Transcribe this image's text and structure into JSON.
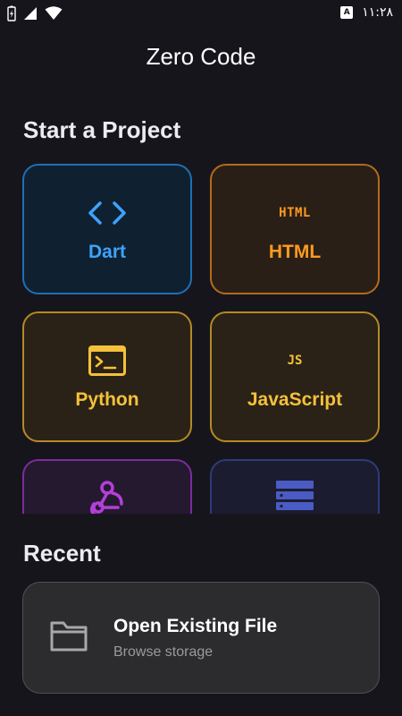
{
  "status_bar": {
    "time": "١١:٢٨",
    "badge_letter": "A",
    "icons": [
      "battery-charging-icon",
      "signal-icon",
      "wifi-icon"
    ]
  },
  "app": {
    "title": "Zero Code"
  },
  "start_section": {
    "heading": "Start a Project",
    "projects": [
      {
        "label": "Dart",
        "icon": "code-brackets-icon",
        "color": "#3ea2ff"
      },
      {
        "label": "HTML",
        "icon": "html-icon",
        "icon_text": "HTML",
        "color": "#ff9a1f"
      },
      {
        "label": "Python",
        "icon": "terminal-icon",
        "color": "#f5c13a"
      },
      {
        "label": "JavaScript",
        "icon": "js-icon",
        "icon_text": "JS",
        "color": "#f5c13a"
      },
      {
        "label": "",
        "icon": "webhook-icon",
        "color": "#b43fd9"
      },
      {
        "label": "",
        "icon": "storage-icon",
        "color": "#4a5bc4"
      }
    ]
  },
  "recent_section": {
    "heading": "Recent",
    "open_file": {
      "title": "Open Existing File",
      "subtitle": "Browse storage",
      "icon": "folder-icon"
    }
  }
}
